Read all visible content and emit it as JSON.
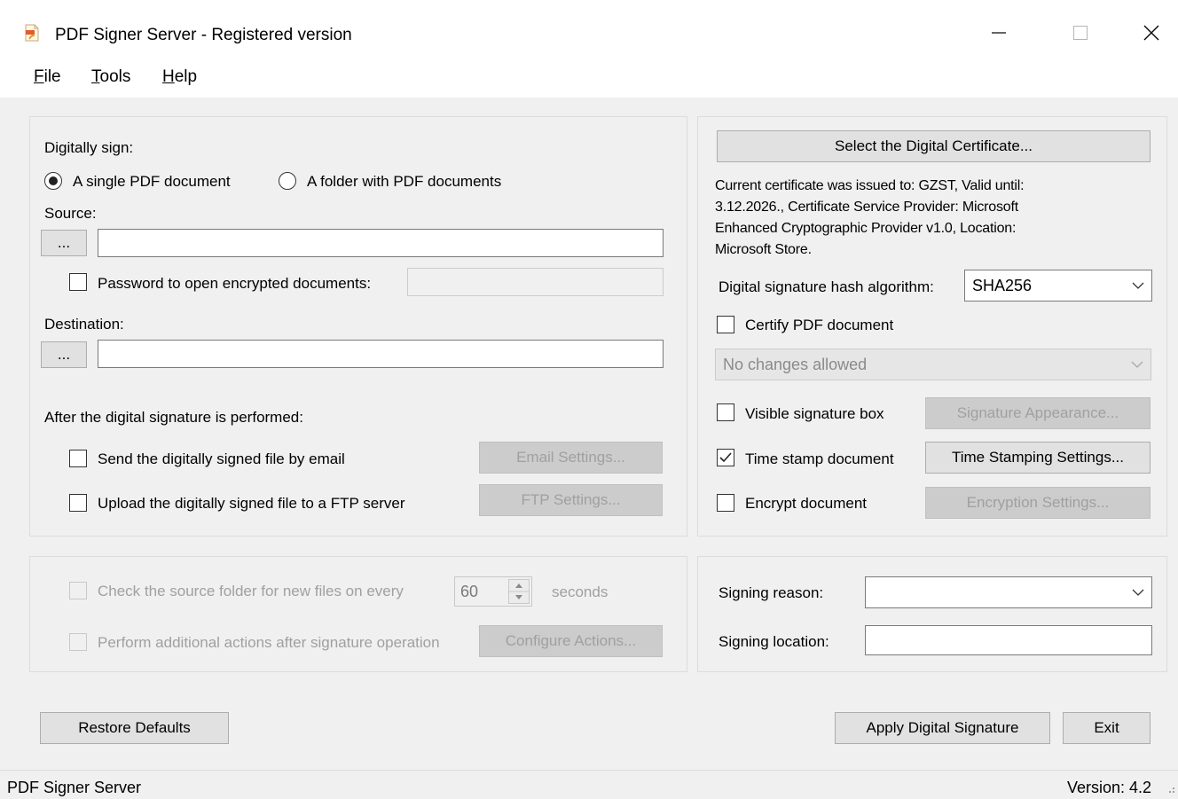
{
  "window": {
    "title": "PDF Signer Server - Registered version"
  },
  "menu": {
    "file": {
      "accel": "F",
      "rest": "ile"
    },
    "tools": {
      "accel": "T",
      "rest": "ools"
    },
    "help": {
      "accel": "H",
      "rest": "elp"
    }
  },
  "sign_panel": {
    "digitally_sign_label": "Digitally sign:",
    "radio_single": "A single PDF document",
    "radio_folder": "A folder with PDF documents",
    "selected_mode": "single",
    "source_label": "Source:",
    "browse_label": "...",
    "source_value": "",
    "password_label": "Password to open encrypted documents:",
    "password_checked": false,
    "password_value": "",
    "destination_label": "Destination:",
    "destination_value": "",
    "after_label": "After the digital signature is performed:",
    "send_email_label": "Send the digitally signed file by email",
    "send_email_checked": false,
    "email_settings_label": "Email Settings...",
    "upload_ftp_label": "Upload the digitally signed file to a FTP server",
    "upload_ftp_checked": false,
    "ftp_settings_label": "FTP Settings..."
  },
  "cert_panel": {
    "select_cert_label": "Select the Digital Certificate...",
    "cert_info_lines": [
      "Current certificate was issued to: GZST, Valid until:",
      "3.12.2026., Certificate Service Provider: Microsoft",
      "Enhanced Cryptographic Provider v1.0, Location:",
      "Microsoft Store."
    ],
    "hash_label": "Digital signature hash algorithm:",
    "hash_value": "SHA256",
    "certify_label": "Certify PDF document",
    "certify_checked": false,
    "certify_option": "No changes allowed",
    "visible_box_label": "Visible signature box",
    "visible_box_checked": false,
    "signature_appearance_label": "Signature Appearance...",
    "timestamp_label": "Time stamp document",
    "timestamp_checked": true,
    "timestamp_settings_label": "Time Stamping Settings...",
    "encrypt_label": "Encrypt document",
    "encrypt_checked": false,
    "encryption_settings_label": "Encryption Settings..."
  },
  "folder_panel": {
    "check_folder_label": "Check the source folder for new files on every",
    "interval_value": "60",
    "seconds_label": "seconds",
    "additional_actions_label": "Perform additional actions after signature operation",
    "configure_actions_label": "Configure Actions..."
  },
  "reason_panel": {
    "reason_label": "Signing reason:",
    "reason_value": "",
    "location_label": "Signing location:",
    "location_value": ""
  },
  "footer": {
    "restore_defaults_label": "Restore Defaults",
    "apply_label": "Apply Digital Signature",
    "exit_label": "Exit"
  },
  "status": {
    "app_name": "PDF Signer Server",
    "version": "Version: 4.2"
  },
  "icons": {
    "app": "pdf-document-icon",
    "minimize": "minimize-icon",
    "maximize": "maximize-icon",
    "close": "close-icon",
    "checkmark": "checkmark-icon",
    "dropdown": "chevron-down-icon",
    "spinner": "spinner-arrows-icon",
    "grip": "resize-grip-icon"
  }
}
